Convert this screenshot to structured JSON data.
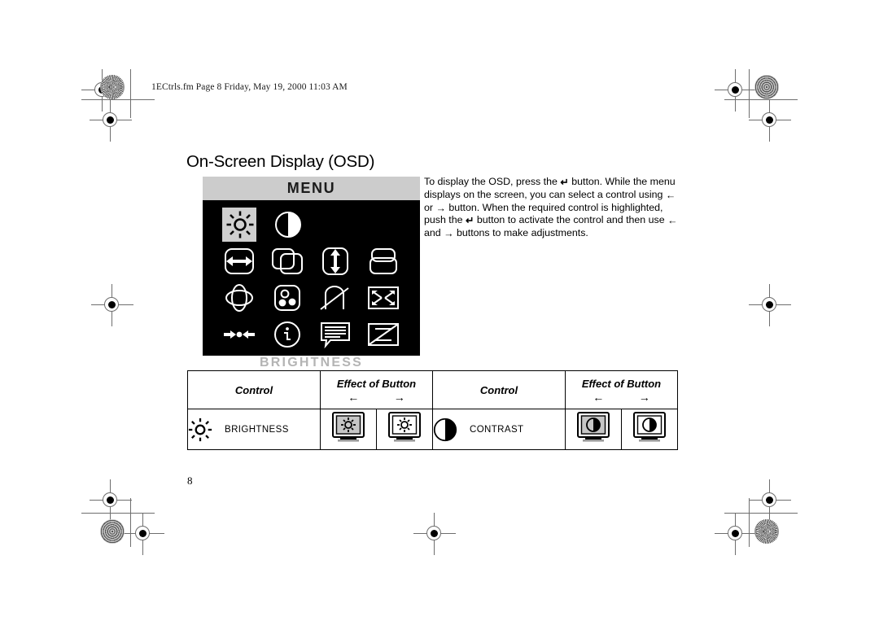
{
  "document": {
    "file_header": "1ECtrls.fm  Page 8  Friday, May 19, 2000  11:03 AM",
    "page_number": "8",
    "title": "On-Screen Display (OSD)"
  },
  "instructions": {
    "seg1": "To display the OSD, press the",
    "enter_glyph": "↵",
    "seg2": "button. While the menu displays on the screen, you can select a control using",
    "left_glyph": "←",
    "seg3": "or",
    "right_glyph": "→",
    "seg4": "button. When the required control is highlighted, push the",
    "seg5": "button to activate the control and then use",
    "seg6": "and",
    "seg7": "buttons to make adjustments."
  },
  "osd": {
    "title": "MENU",
    "selected_label": "BRIGHTNESS",
    "highlight_color": "#cfcfcf",
    "titlebar_color": "#cccccc",
    "screen_color": "#000000",
    "icons": [
      {
        "name": "brightness-icon",
        "row": 1,
        "col": 1,
        "selected": true
      },
      {
        "name": "contrast-icon",
        "row": 1,
        "col": 2,
        "selected": false
      },
      {
        "name": "horizontal-size-icon",
        "row": 2,
        "col": 1,
        "selected": false
      },
      {
        "name": "horizontal-position-icon",
        "row": 2,
        "col": 2,
        "selected": false
      },
      {
        "name": "vertical-size-icon",
        "row": 2,
        "col": 3,
        "selected": false
      },
      {
        "name": "vertical-position-icon",
        "row": 2,
        "col": 4,
        "selected": false
      },
      {
        "name": "pincushion-icon",
        "row": 3,
        "col": 1,
        "selected": false
      },
      {
        "name": "color-temperature-icon",
        "row": 3,
        "col": 2,
        "selected": false
      },
      {
        "name": "tilt-icon",
        "row": 3,
        "col": 3,
        "selected": false
      },
      {
        "name": "zoom-icon",
        "row": 3,
        "col": 4,
        "selected": false
      },
      {
        "name": "degauss-icon",
        "row": 4,
        "col": 1,
        "selected": false
      },
      {
        "name": "information-icon",
        "row": 4,
        "col": 2,
        "selected": false
      },
      {
        "name": "osd-language-icon",
        "row": 4,
        "col": 3,
        "selected": false
      },
      {
        "name": "moire-icon",
        "row": 4,
        "col": 4,
        "selected": false
      }
    ]
  },
  "control_table": {
    "headers": {
      "control": "Control",
      "effect": "Effect of Button",
      "left_arrow": "←",
      "right_arrow": "→"
    },
    "rows": [
      {
        "icon": "brightness-icon",
        "name": "BRIGHTNESS",
        "effect_left": "monitor-dim-icon",
        "effect_right": "monitor-bright-icon"
      },
      {
        "icon": "contrast-icon",
        "name": "CONTRAST",
        "effect_left": "monitor-low-contrast-icon",
        "effect_right": "monitor-high-contrast-icon"
      }
    ]
  }
}
